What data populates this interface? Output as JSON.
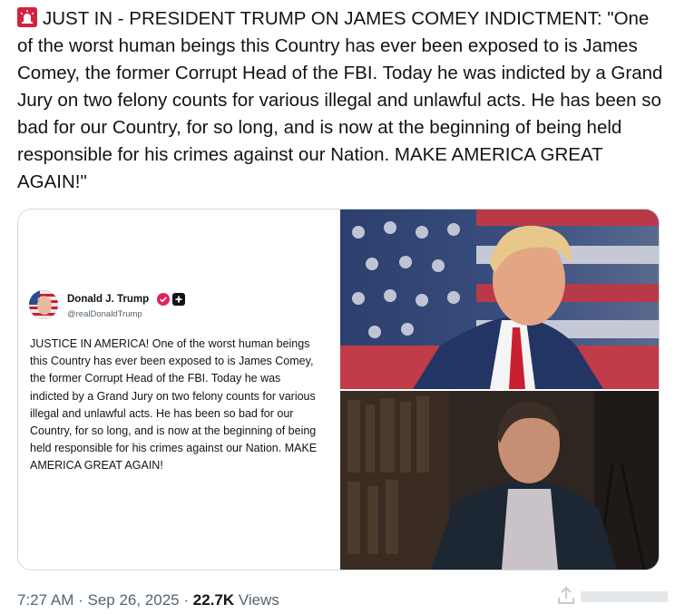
{
  "post": {
    "text": "JUST IN - PRESIDENT TRUMP ON JAMES COMEY INDICTMENT: \"One of the worst human beings this Country has ever been exposed to is James Comey, the former Corrupt Head of the FBI. Today he was indicted by a Grand Jury on two felony counts for various illegal and unlawful acts. He has been so bad for our Country, for so long, and is now at the beginning of being held responsible for his crimes against our Nation. MAKE AMERICA GREAT AGAIN!\"",
    "leading_icon": "police-siren-icon"
  },
  "embedded_post": {
    "display_name": "Donald J. Trump",
    "handle": "@realDonaldTrump",
    "body": "JUSTICE IN AMERICA! One of the worst human beings this Country has ever been exposed to is James Comey, the former Corrupt Head of the FBI. Today he was indicted by a Grand Jury on two felony counts for various illegal and unlawful acts. He has been so bad for our Country, for so long, and is now at the beginning of being held responsible for his crimes against our Nation. MAKE AMERICA GREAT AGAIN!",
    "badge_color": "#e0245e"
  },
  "meta": {
    "time": "7:27 AM",
    "sep1": " · ",
    "date": "Sep 26, 2025",
    "sep2": " · ",
    "views_count": "22.7K",
    "views_label": " Views"
  },
  "colors": {
    "text": "#0f1419",
    "secondary": "#536471",
    "border": "#cfd9de",
    "siren": "#d4213d"
  }
}
